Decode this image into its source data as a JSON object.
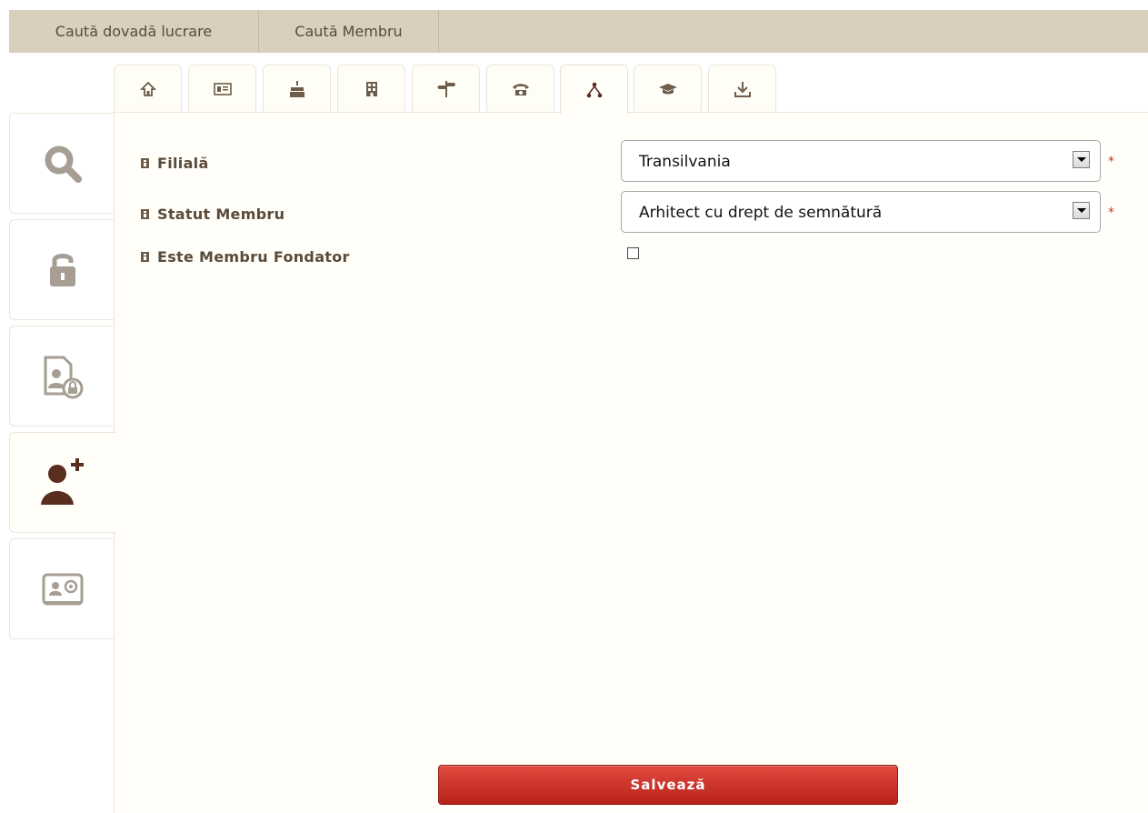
{
  "topbar": {
    "items": [
      "Caută dovadă lucrare",
      "Caută Membru"
    ]
  },
  "tabs": [
    {
      "icon": "home-icon"
    },
    {
      "icon": "id-card-icon"
    },
    {
      "icon": "birthday-cake-icon"
    },
    {
      "icon": "building-icon"
    },
    {
      "icon": "signpost-icon"
    },
    {
      "icon": "phone-icon"
    },
    {
      "icon": "sitemap-icon",
      "active": true
    },
    {
      "icon": "graduation-cap-icon"
    },
    {
      "icon": "download-icon"
    }
  ],
  "sidebar": [
    {
      "icon": "search-icon"
    },
    {
      "icon": "lock-icon"
    },
    {
      "icon": "user-document-lock-icon"
    },
    {
      "icon": "add-user-icon",
      "active": true
    },
    {
      "icon": "contact-card-icon"
    }
  ],
  "form": {
    "filiala_label": "Filială",
    "filiala_value": "Transilvania",
    "statut_label": "Statut Membru",
    "statut_value": "Arhitect cu drept de semnătură",
    "fondator_label": "Este Membru Fondator",
    "fondator_checked": false,
    "required_mark": "*",
    "save_label": "Salvează"
  },
  "colors": {
    "topbar_bg": "#d8cfbd",
    "panel_bg": "#fffef8",
    "accent_brown": "#5a2d1f",
    "save_button": "#c62d22",
    "required": "#c0392b"
  }
}
